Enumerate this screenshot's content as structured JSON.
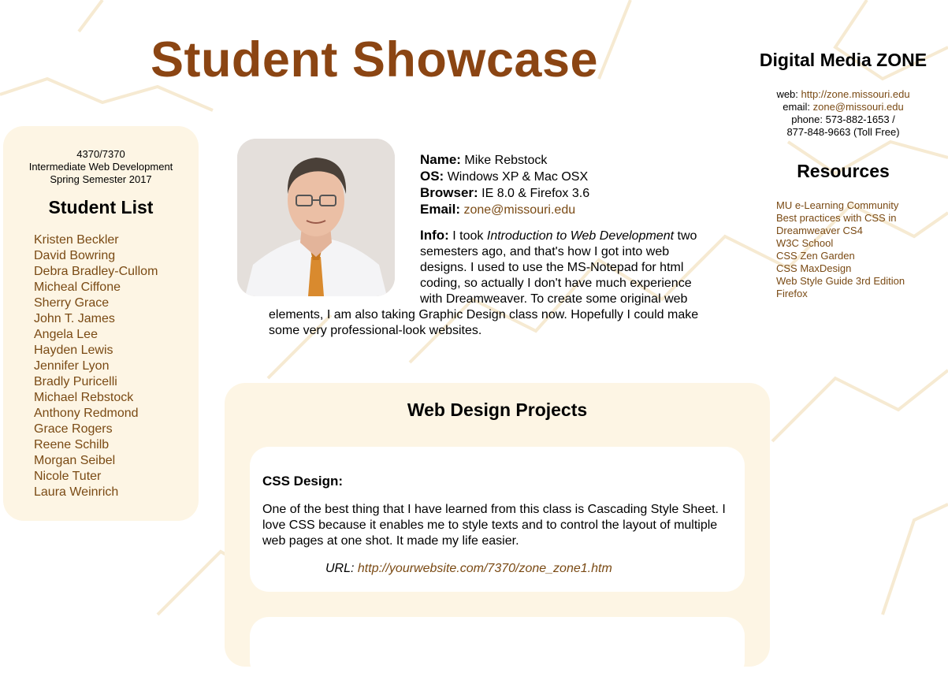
{
  "header": {
    "title": "Student Showcase"
  },
  "left_panel": {
    "course_number": "4370/7370",
    "course_name": "Intermediate Web Development",
    "semester": "Spring Semester 2017",
    "heading": "Student List",
    "students": [
      "Kristen Beckler",
      "David Bowring",
      "Debra Bradley-Cullom",
      "Micheal Ciffone",
      "Sherry Grace",
      "John T. James",
      "Angela Lee",
      "Hayden Lewis",
      "Jennifer Lyon",
      "Bradly Puricelli",
      "Michael Rebstock",
      "Anthony Redmond",
      "Grace Rogers",
      "Reene Schilb",
      "Morgan Seibel",
      "Nicole Tuter",
      "Laura Weinrich"
    ]
  },
  "profile": {
    "name_label": "Name:",
    "name": "Mike Rebstock",
    "os_label": "OS:",
    "os": "Windows XP & Mac OSX",
    "browser_label": "Browser:",
    "browser": "IE 8.0 & Firefox 3.6",
    "email_label": "Email:",
    "email": "zone@missouri.edu",
    "info_label": "Info:",
    "info_pre": "I took",
    "info_course": "Introduction to Web Development",
    "info_post": "two semesters ago, and that's how I got into web designs. I used to use the MS-Notepad for html coding, so actually I don't have much experience with Dreamweaver. To create some original web elements, I am also taking Graphic Design class now. Hopefully I could make some very professional-look websites."
  },
  "sidebar_right": {
    "heading": "Digital Media ZONE",
    "web_label": "web:",
    "web": "http://zone.missouri.edu",
    "email_label": "email:",
    "email": "zone@missouri.edu",
    "phone_line1": "phone: 573-882-1653 /",
    "phone_line2": "877-848-9663 (Toll Free)",
    "resources_heading": "Resources",
    "resources": [
      "MU e-Learning Community",
      "Best practices with CSS in Dreamweaver CS4",
      "W3C School",
      "CSS Zen Garden",
      "CSS MaxDesign",
      "Web Style Guide 3rd Edition",
      "Firefox"
    ]
  },
  "projects": {
    "heading": "Web Design Projects",
    "items": [
      {
        "title": "CSS Design:",
        "description": "One of the best thing that I have learned from this class is Cascading Style Sheet. I love CSS because it enables me to style texts and to control the layout of multiple web pages at one shot. It made my life easier.",
        "url_label": "URL:",
        "url": "http://yourwebsite.com/7370/zone_zone1.htm"
      }
    ]
  },
  "colors": {
    "title": "#8b4513",
    "link": "#7a4a14",
    "panel_bg": "#fdf5e4",
    "bg_lines": "#f6ead2"
  },
  "icons": [
    "profile-photo"
  ]
}
